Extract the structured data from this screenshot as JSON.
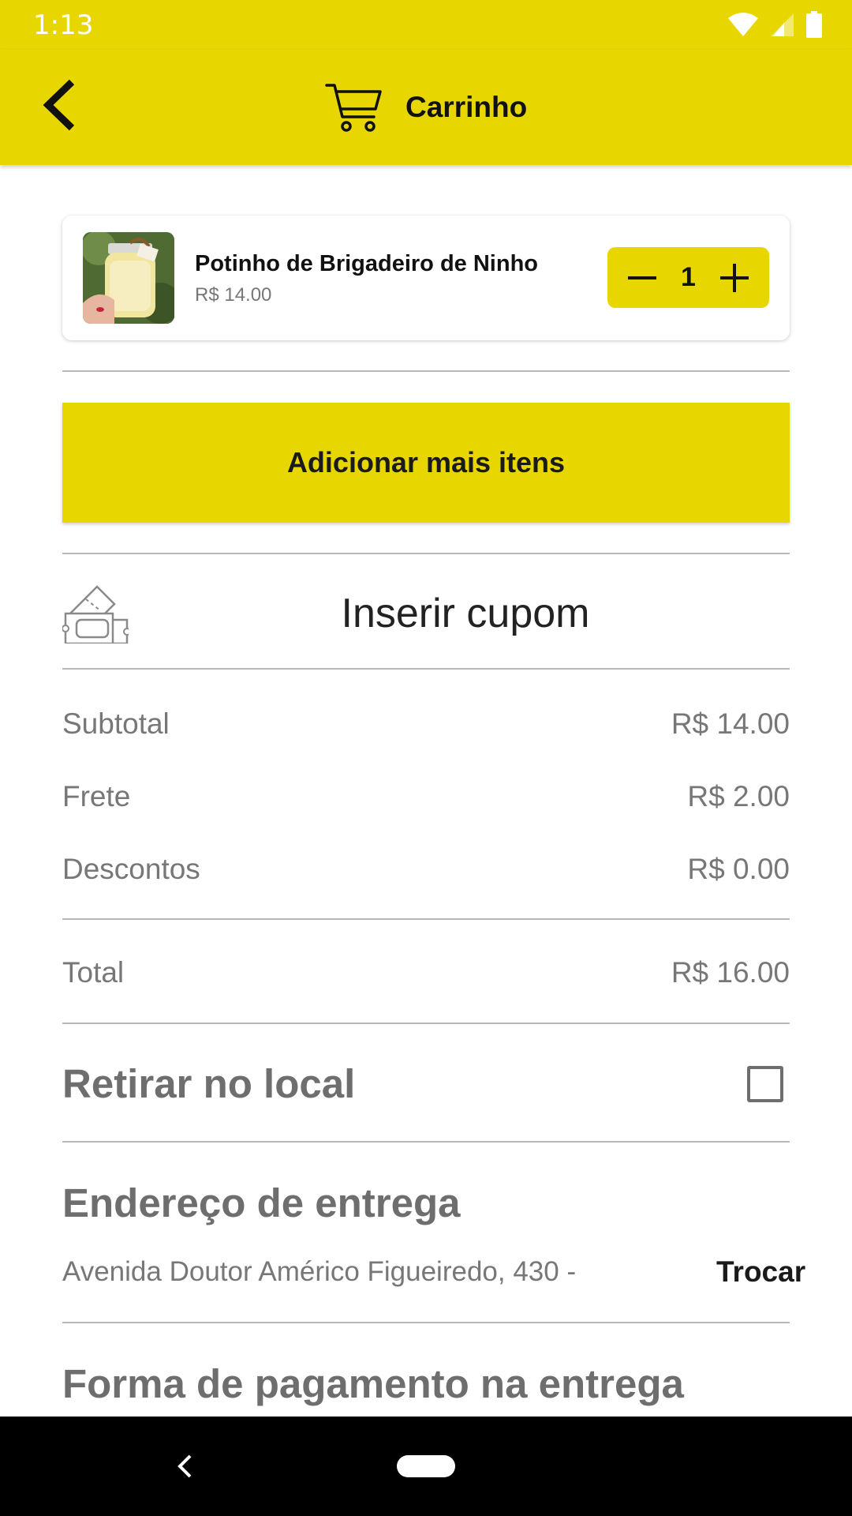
{
  "status_bar": {
    "time": "1:13"
  },
  "header": {
    "title": "Carrinho"
  },
  "cart": {
    "items": [
      {
        "name": "Potinho de Brigadeiro de Ninho",
        "price": "R$ 14.00",
        "quantity": "1"
      }
    ]
  },
  "actions": {
    "add_more_label": "Adicionar mais itens"
  },
  "coupon": {
    "label": "Inserir cupom"
  },
  "summary": {
    "subtotal_label": "Subtotal",
    "subtotal_value": "R$ 14.00",
    "shipping_label": "Frete",
    "shipping_value": "R$ 2.00",
    "discount_label": "Descontos",
    "discount_value": "R$ 0.00",
    "total_label": "Total",
    "total_value": "R$ 16.00"
  },
  "pickup": {
    "label": "Retirar no local",
    "checked": false
  },
  "delivery": {
    "title": "Endereço de entrega",
    "address": "Avenida Doutor Américo Figueiredo, 430 -",
    "change_label": "Trocar"
  },
  "payment": {
    "title": "Forma de pagamento na entrega"
  },
  "colors": {
    "accent": "#e8d600",
    "text_muted": "#777777",
    "nav_bar": "#000000"
  }
}
